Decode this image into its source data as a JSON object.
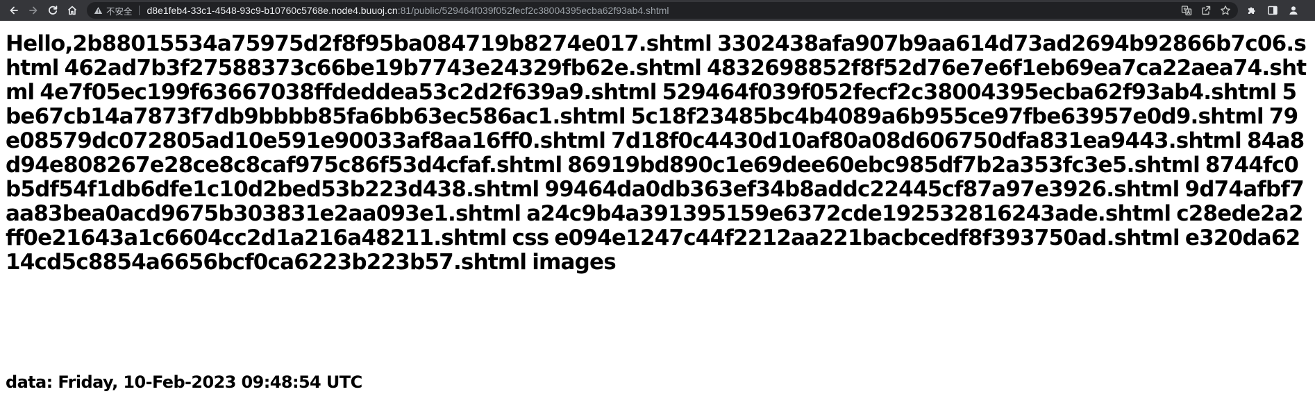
{
  "browser": {
    "security_label": "不安全",
    "url_host": "d8e1feb4-33c1-4548-93c9-b10760c5768e.node4.buuoj.cn",
    "url_rest": ":81/public/529464f039f052fecf2c38004395ecba62f93ab4.shtml",
    "icons": {
      "back": "back-arrow-icon",
      "forward": "forward-arrow-icon",
      "reload": "reload-icon",
      "home": "home-icon",
      "security": "warning-triangle-icon",
      "translate": "translate-icon",
      "share": "share-icon",
      "bookmark": "star-icon",
      "extensions": "puzzle-icon",
      "sidepanel": "side-panel-icon",
      "profile": "profile-icon"
    },
    "colors": {
      "toolbar": "#35363a",
      "omnibox": "#202124",
      "host_text": "#e8eaed",
      "path_text": "#9aa0a6"
    }
  },
  "page": {
    "greeting": "Hello,",
    "files": [
      "2b88015534a75975d2f8f95ba084719b8274e017.shtml",
      "3302438afa907b9aa614d73ad2694b92866b7c06.shtml",
      "462ad7b3f27588373c66be19b7743e24329fb62e.shtml",
      "4832698852f8f52d76e7e6f1eb69ea7ca22aea74.shtml",
      "4e7f05ec199f63667038ffdeddea53c2d2f639a9.shtml",
      "529464f039f052fecf2c38004395ecba62f93ab4.shtml",
      "5be67cb14a7873f7db9bbbb85fa6bb63ec586ac1.shtml",
      "5c18f23485bc4b4089a6b955ce97fbe63957e0d9.shtml",
      "79e08579dc072805ad10e591e90033af8aa16ff0.shtml",
      "7d18f0c4430d10af80a08d606750dfa831ea9443.shtml",
      "84a8d94e808267e28ce8c8caf975c86f53d4cfaf.shtml",
      "86919bd890c1e69dee60ebc985df7b2a353fc3e5.shtml",
      "8744fc0b5df54f1db6dfe1c10d2bed53b223d438.shtml",
      "99464da0db363ef34b8addc22445cf87a97e3926.shtml",
      "9d74afbf7aa83bea0acd9675b303831e2aa093e1.shtml",
      "a24c9b4a391395159e6372cde192532816243ade.shtml",
      "c28ede2a2ff0e21643a1c6604cc2d1a216a48211.shtml",
      "css",
      "e094e1247c44f2212aa221bacbcedf8f393750ad.shtml",
      "e320da6214cd5c8854a6656bcf0ca6223b223b57.shtml",
      "images"
    ],
    "date_text": "data: Friday, 10-Feb-2023 09:48:54 UTC"
  }
}
